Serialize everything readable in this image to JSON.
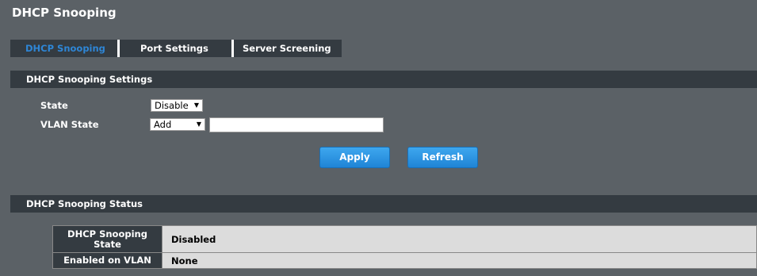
{
  "page": {
    "title": "DHCP Snooping"
  },
  "tabs": [
    {
      "label": "DHCP Snooping",
      "active": true
    },
    {
      "label": "Port Settings",
      "active": false
    },
    {
      "label": "Server Screening",
      "active": false
    }
  ],
  "settings": {
    "title": "DHCP Snooping Settings",
    "state_label": "State",
    "state_value": "Disable",
    "vlan_state_label": "VLAN State",
    "vlan_state_value": "Add",
    "vlan_input_value": "",
    "apply_label": "Apply",
    "refresh_label": "Refresh"
  },
  "status": {
    "title": "DHCP Snooping Status",
    "rows": [
      {
        "label": "DHCP Snooping State",
        "value": "Disabled"
      },
      {
        "label": "Enabled on VLAN",
        "value": "None"
      }
    ]
  },
  "colors": {
    "background": "#5b6166",
    "bar": "#343b41",
    "active_tab": "#2e86d6",
    "button": "#2b93e2",
    "table_value_bg": "#dcdcdc"
  },
  "icons": {
    "dropdown": "dropdown-arrow-icon"
  }
}
